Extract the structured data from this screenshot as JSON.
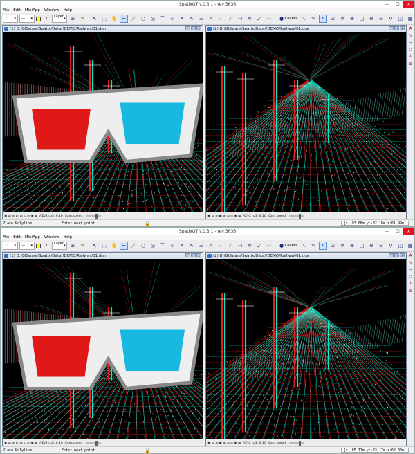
{
  "app": {
    "title": "SpatixQT v.0.3.1 - rev 3636",
    "menu": [
      "File",
      "Edit",
      "MiniApp",
      "Window",
      "Help"
    ],
    "toolbar": {
      "line_weight": "7",
      "line_style": "—",
      "color_index": "7",
      "level": "Layer 1",
      "layer_number": "0",
      "layers_label": "Layers"
    },
    "views": [
      {
        "title": "(1) D:/GISware/Spatix/Data/!DEMO/Railway/01.dgn",
        "zoom_label": "AZv2 rpS: 6.10",
        "cam_label": "Cam.speed:"
      },
      {
        "title": "(2) D:/GISware/Spatix/Data/!DEMO/Railway/01.dgn",
        "zoom_label": "AZv2 rpS: 6.10",
        "cam_label": "Cam.speed:"
      }
    ],
    "status": {
      "command": "Place Polyline",
      "prompt": "Enter next point"
    }
  },
  "windows": [
    {
      "coords": "[x:-93.06m y:-32.18m z:61.99m]"
    },
    {
      "coords": "[x:-85.77m y:-33.17m z:62.00m]"
    }
  ],
  "colors": {
    "red": "#ff2020",
    "cyan": "#00ffe0",
    "background": "#000000",
    "accent": "#cfe3ff"
  }
}
